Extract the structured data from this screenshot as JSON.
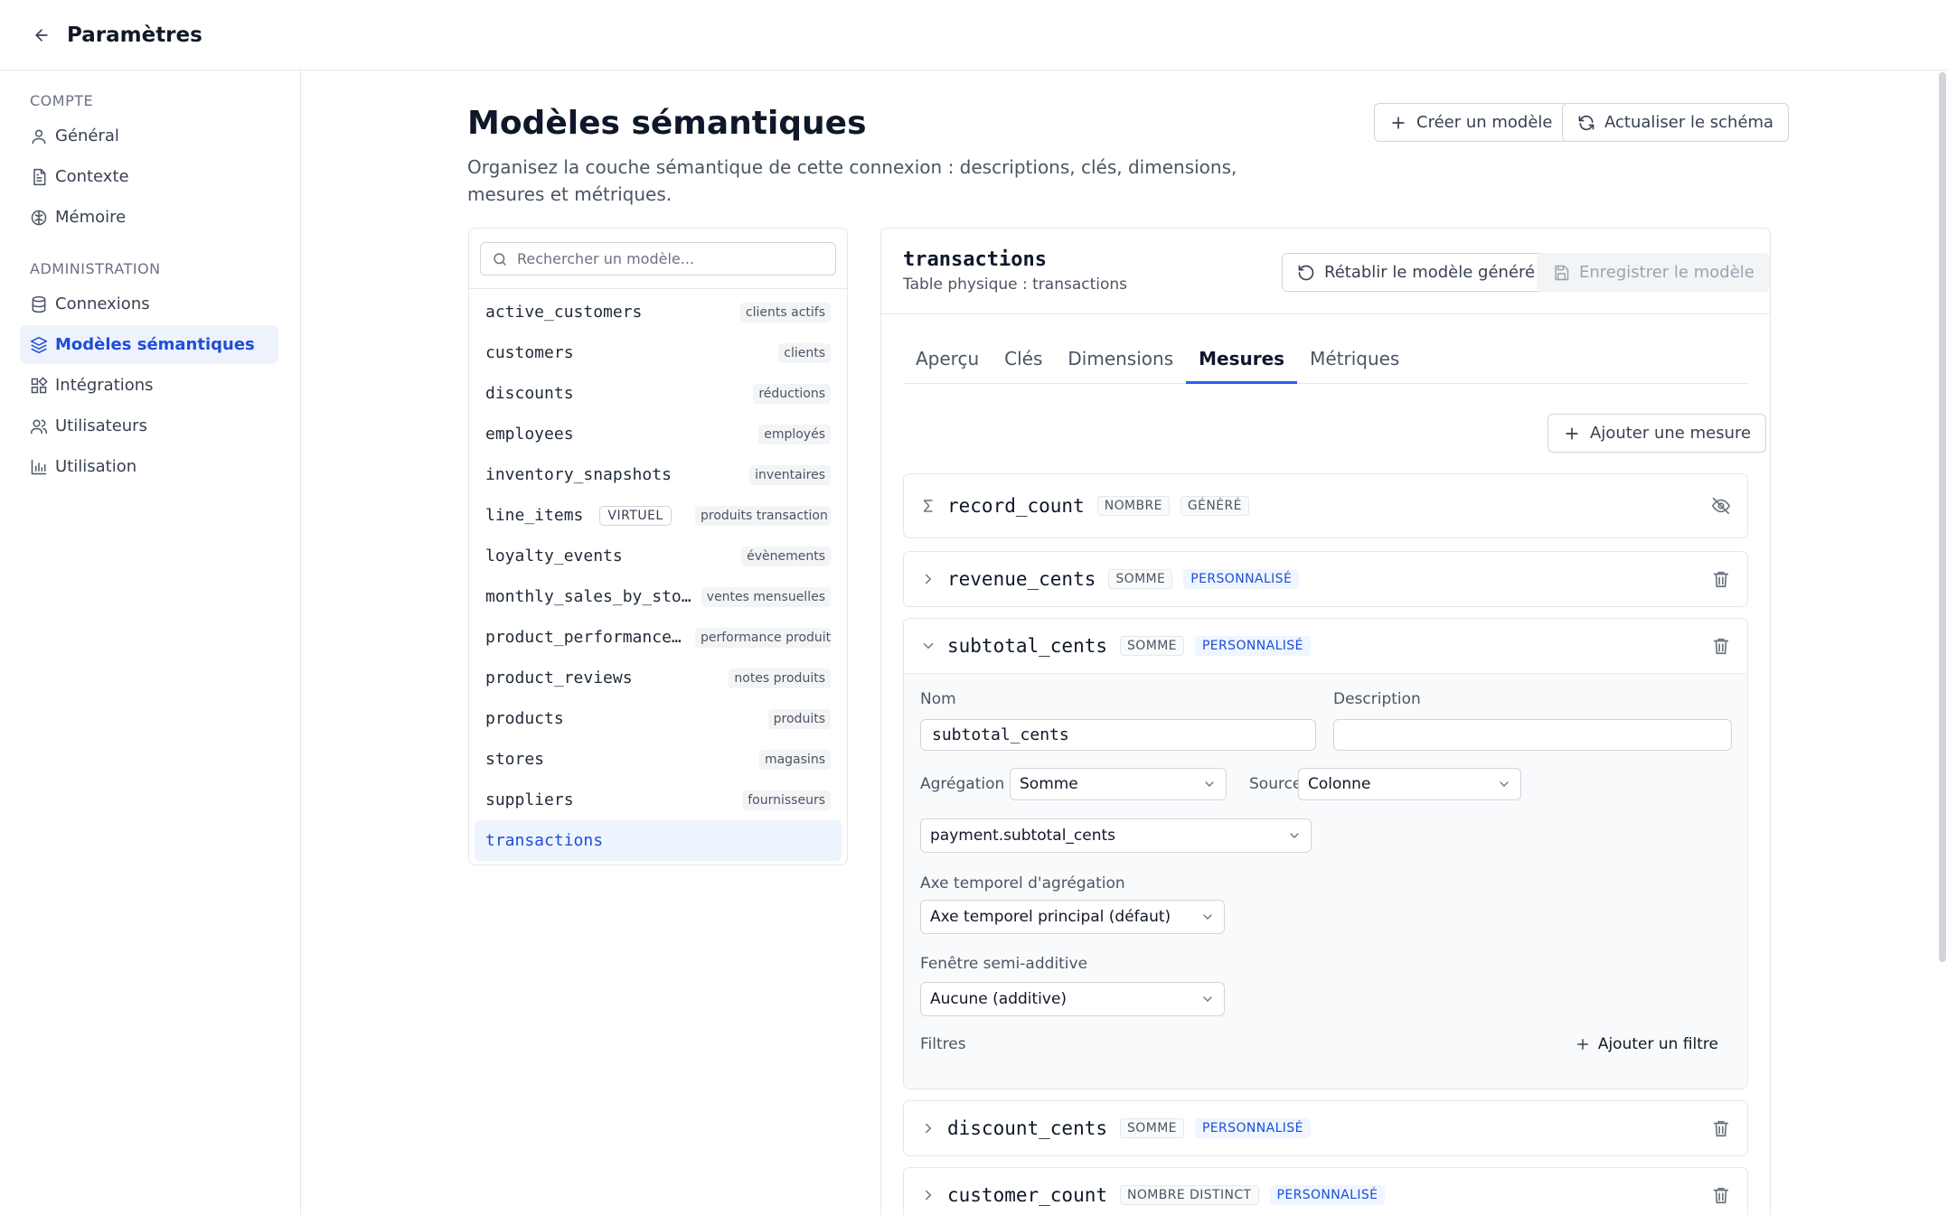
{
  "header": {
    "title": "Paramètres"
  },
  "sidebar": {
    "section_account": "COMPTE",
    "section_admin": "ADMINISTRATION",
    "items": [
      {
        "label": "Général",
        "icon": "user-icon"
      },
      {
        "label": "Contexte",
        "icon": "document-icon"
      },
      {
        "label": "Mémoire",
        "icon": "brain-icon"
      },
      {
        "label": "Connexions",
        "icon": "database-icon"
      },
      {
        "label": "Modèles sémantiques",
        "icon": "layers-icon"
      },
      {
        "label": "Intégrations",
        "icon": "puzzle-icon"
      },
      {
        "label": "Utilisateurs",
        "icon": "users-icon"
      },
      {
        "label": "Utilisation",
        "icon": "bar-chart-icon"
      }
    ]
  },
  "main": {
    "title": "Modèles sémantiques",
    "description": "Organisez la couche sémantique de cette connexion : descriptions, clés, dimensions, mesures et métriques.",
    "create_button": "Créer un modèle",
    "refresh_button": "Actualiser le schéma"
  },
  "model_list": {
    "search_placeholder": "Rechercher un modèle...",
    "models": [
      {
        "name": "active_customers",
        "tag": "clients actifs"
      },
      {
        "name": "customers",
        "tag": "clients"
      },
      {
        "name": "discounts",
        "tag": "réductions"
      },
      {
        "name": "employees",
        "tag": "employés"
      },
      {
        "name": "inventory_snapshots",
        "tag": "inventaires"
      },
      {
        "name": "line_items",
        "badge": "VIRTUEL",
        "tag": "produits transaction"
      },
      {
        "name": "loyalty_events",
        "tag": "évènements"
      },
      {
        "name": "monthly_sales_by_sto…",
        "tag": "ventes mensuelles"
      },
      {
        "name": "product_performance…",
        "tag": "performance produit"
      },
      {
        "name": "product_reviews",
        "tag": "notes produits"
      },
      {
        "name": "products",
        "tag": "produits"
      },
      {
        "name": "stores",
        "tag": "magasins"
      },
      {
        "name": "suppliers",
        "tag": "fournisseurs"
      },
      {
        "name": "transactions",
        "tag": ""
      }
    ]
  },
  "detail": {
    "name": "transactions",
    "subtitle": "Table physique : transactions",
    "reset_button": "Rétablir le modèle généré",
    "save_button": "Enregistrer le modèle",
    "tabs": [
      "Aperçu",
      "Clés",
      "Dimensions",
      "Mesures",
      "Métriques"
    ],
    "add_measure_button": "Ajouter une mesure",
    "measures": [
      {
        "name": "record_count",
        "badges": [
          "NOMBRE",
          "GÉNÉRÉ"
        ]
      },
      {
        "name": "revenue_cents",
        "badges": [
          "SOMME",
          "PERSONNALISÉ"
        ]
      },
      {
        "name": "subtotal_cents",
        "badges": [
          "SOMME",
          "PERSONNALISÉ"
        ]
      },
      {
        "name": "discount_cents",
        "badges": [
          "SOMME",
          "PERSONNALISÉ"
        ]
      },
      {
        "name": "customer_count",
        "badges": [
          "NOMBRE DISTINCT",
          "PERSONNALISÉ"
        ]
      }
    ],
    "form": {
      "name_label": "Nom",
      "name_value": "subtotal_cents",
      "description_label": "Description",
      "description_value": "",
      "aggregation_label": "Agrégation",
      "aggregation_value": "Somme",
      "source_label": "Source",
      "source_value": "Colonne",
      "column_value": "payment.subtotal_cents",
      "time_axis_label": "Axe temporel d'agrégation",
      "time_axis_value": "Axe temporel principal (défaut)",
      "window_label": "Fenêtre semi-additive",
      "window_value": "Aucune (additive)",
      "filters_label": "Filtres",
      "add_filter_button": "Ajouter un filtre"
    }
  }
}
